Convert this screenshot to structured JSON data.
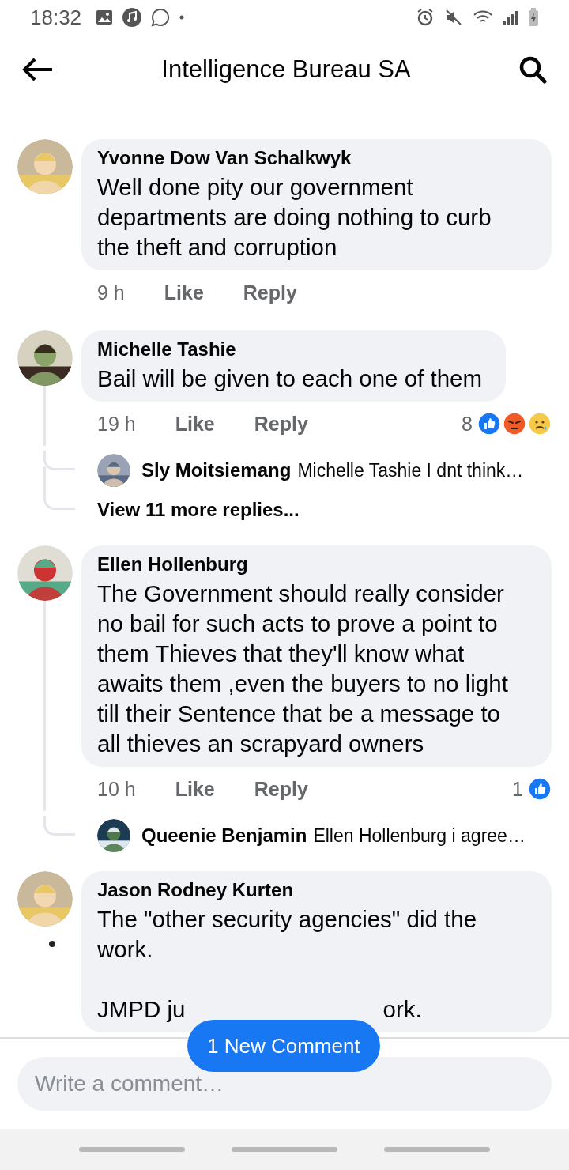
{
  "status_bar": {
    "time": "18:32"
  },
  "header": {
    "title": "Intelligence Bureau SA"
  },
  "comments": [
    {
      "author": "Yvonne Dow Van Schalkwyk",
      "paragraphs": [
        [
          "Well done pity our government departments are doing nothing to curb the theft and corruption"
        ]
      ],
      "time": "9 h",
      "actions": [
        "Like",
        "Reply"
      ]
    },
    {
      "author": "Michelle Tashie",
      "paragraphs": [
        [
          "Bail will be given to each one of them"
        ]
      ],
      "time": "19 h",
      "actions": [
        "Like",
        "Reply"
      ],
      "reaction_count": "8",
      "reactions": [
        {
          "kind": "like"
        },
        {
          "kind": "angry"
        },
        {
          "kind": "sad"
        }
      ],
      "replies": [
        {
          "author": "Sly Moitsiemang",
          "text": "Michelle Tashie I dnt think…"
        }
      ],
      "more_replies": "View 11 more replies..."
    },
    {
      "author": "Ellen Hollenburg",
      "paragraphs": [
        [
          "The Government should really consider no bail for such acts to prove a point to them Thieves that they'll know what awaits them ,even the buyers to no light till their Sentence that be a message to all thieves an  scrapyard owners"
        ]
      ],
      "time": "10 h",
      "actions": [
        "Like",
        "Reply"
      ],
      "reaction_count": "1",
      "reactions": [
        {
          "kind": "like"
        }
      ],
      "replies": [
        {
          "author": "Queenie Benjamin",
          "text": "Ellen Hollenburg i agree…"
        }
      ]
    },
    {
      "author": "Jason Rodney Kurten",
      "paragraphs": [
        [
          "The \"other security agencies\" did the work."
        ],
        [
          "JMPD ju",
          "ork."
        ]
      ]
    }
  ],
  "new_comment_button": "1 New Comment",
  "composer": {
    "placeholder": "Write a comment…"
  }
}
